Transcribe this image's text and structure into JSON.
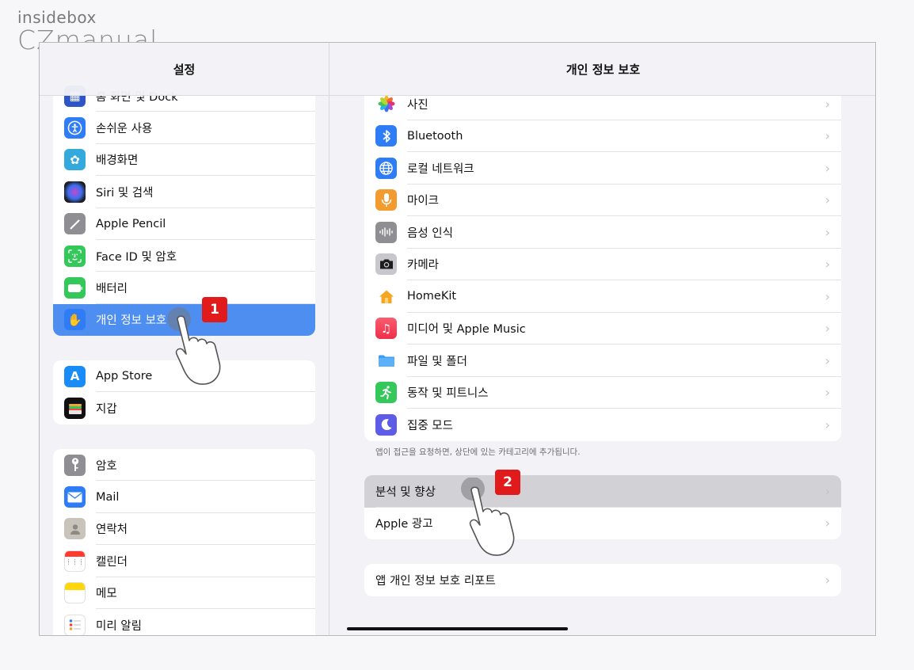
{
  "watermark": {
    "line1": "insidebox",
    "line2": "CZmanual"
  },
  "left_pane": {
    "title": "설정",
    "group1": [
      {
        "label": "홈 화면 및 Dock",
        "icon": "grid-icon",
        "color": "#2e55c7"
      },
      {
        "label": "손쉬운 사용",
        "icon": "accessibility-icon",
        "color": "#2f7df6"
      },
      {
        "label": "배경화면",
        "icon": "flower-icon",
        "color": "#34aadc"
      },
      {
        "label": "Siri 및 검색",
        "icon": "siri-icon",
        "color": "#1c1c1e"
      },
      {
        "label": "Apple Pencil",
        "icon": "pencil-icon",
        "color": "#8e8e93"
      },
      {
        "label": "Face ID 및 암호",
        "icon": "faceid-icon",
        "color": "#34c759"
      },
      {
        "label": "배터리",
        "icon": "battery-icon",
        "color": "#34c759"
      },
      {
        "label": "개인 정보 보호",
        "icon": "hand-icon",
        "color": "#2f7df6"
      }
    ],
    "group2": [
      {
        "label": "App Store",
        "icon": "appstore-icon",
        "color": "#1a8cf7"
      },
      {
        "label": "지갑",
        "icon": "wallet-icon",
        "color": "#111111"
      }
    ],
    "group3": [
      {
        "label": "암호",
        "icon": "key-icon",
        "color": "#8e8e93"
      },
      {
        "label": "Mail",
        "icon": "mail-icon",
        "color": "#2f7df6"
      },
      {
        "label": "연락처",
        "icon": "contacts-icon",
        "color": "#b8b2a8"
      },
      {
        "label": "캘린더",
        "icon": "calendar-icon",
        "color": "#ffffff"
      },
      {
        "label": "메모",
        "icon": "notes-icon",
        "color": "#ffd60a"
      },
      {
        "label": "미리 알림",
        "icon": "reminders-icon",
        "color": "#ffffff"
      }
    ]
  },
  "right_pane": {
    "title": "개인 정보 보호",
    "group1": [
      {
        "label": "사진",
        "icon": "photos-icon",
        "color": "#ffffff"
      },
      {
        "label": "Bluetooth",
        "icon": "bluetooth-icon",
        "color": "#2f7df6"
      },
      {
        "label": "로컬 네트워크",
        "icon": "globe-icon",
        "color": "#2f7df6"
      },
      {
        "label": "마이크",
        "icon": "mic-icon",
        "color": "#f29b2f"
      },
      {
        "label": "음성 인식",
        "icon": "waveform-icon",
        "color": "#8e8e93"
      },
      {
        "label": "카메라",
        "icon": "camera-icon",
        "color": "#8e8e93"
      },
      {
        "label": "HomeKit",
        "icon": "home-icon",
        "color": "#ffffff"
      },
      {
        "label": "미디어 및 Apple Music",
        "icon": "music-icon",
        "color": "#f0384f"
      },
      {
        "label": "파일 및 폴더",
        "icon": "folder-icon",
        "color": "#ffffff"
      },
      {
        "label": "동작 및 피트니스",
        "icon": "fitness-icon",
        "color": "#34c759"
      },
      {
        "label": "집중 모드",
        "icon": "moon-icon",
        "color": "#5e5ce6"
      }
    ],
    "note": "앱이 접근을 요청하면, 상단에 있는 카테고리에 추가됩니다.",
    "group2": [
      {
        "label": "분석 및 향상"
      },
      {
        "label": "Apple 광고"
      }
    ],
    "group3": [
      {
        "label": "앱 개인 정보 보호 리포트"
      }
    ],
    "chevron": "›"
  },
  "badges": {
    "step1": "1",
    "step2": "2"
  }
}
